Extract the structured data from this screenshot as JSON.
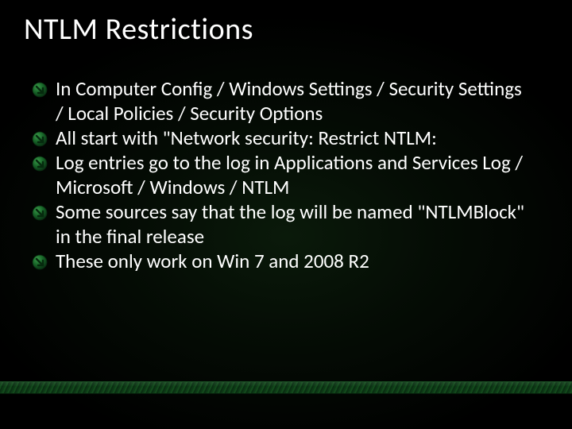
{
  "title": "NTLM Restrictions",
  "bullets": [
    {
      "text": "In Computer Config / Windows Settings / Security Settings / Local Policies / Security Options"
    },
    {
      "text": "All start with \"Network security:  Restrict NTLM:"
    },
    {
      "text": "Log entries go to the log in Applications and Services Log / Microsoft / Windows / NTLM"
    },
    {
      "text": "Some sources say that the log will be named \"NTLMBlock\" in the final release"
    },
    {
      "text": "These only work on Win 7 and 2008 R2"
    }
  ],
  "icon_name": "arrow-bullet-icon",
  "colors": {
    "accent": "#1a6b2a",
    "bg": "#000000",
    "text": "#ffffff"
  }
}
